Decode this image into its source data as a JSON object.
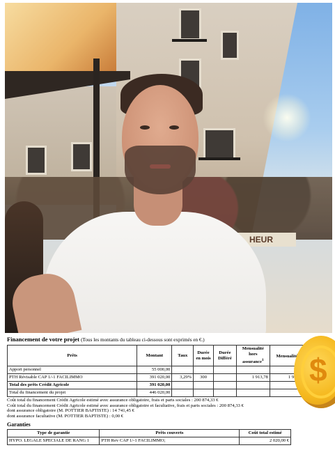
{
  "photo": {
    "sign_text": "HEUR"
  },
  "document": {
    "title": "Financement de votre projet",
    "title_note": "(Tous les montants du tableau ci-dessous sont exprimés en €.)",
    "table": {
      "headers": [
        "Prêts",
        "Montant",
        "Taux",
        "Durée en mois",
        "Durée Différé",
        "Mensualité hors assurance",
        "Mensualité"
      ],
      "header_footnotes": [
        "",
        "",
        "",
        "",
        "",
        "1",
        "2"
      ],
      "rows": [
        [
          "Apport personnel",
          "55 000,00",
          "",
          "",
          "",
          "",
          ""
        ],
        [
          "PTH Révisable CAP 1/-1 FACILIMMO",
          "391 020,00",
          "3,29%",
          "300",
          "",
          "1 913,78",
          "1 962,92"
        ],
        [
          "Total des prêts Crédit Agricole",
          "391 020,00",
          "",
          "",
          "",
          "",
          ""
        ],
        [
          "Total du financement du projet",
          "446 020,00",
          "",
          "",
          "",
          "",
          ""
        ]
      ],
      "extra_header": "M"
    },
    "lines": [
      "Coût total du financement Crédit Agricole estimé avec assurance obligatoire, frais et parts sociales : 200 874,33 €",
      "Coût total du financement Crédit Agricole estimé avec assurance obligatoire et facultative, frais et parts sociales : 200 874,33 €",
      "dont assurance obligatoire (M. POTTIER BAPTISTE) : 14 741,45 €",
      "dont assurance facultative (M. POTTIER BAPTISTE) : 0,00 €"
    ],
    "guarantees": {
      "title": "Garanties",
      "headers": [
        "Type de garantie",
        "Prêts couverts",
        "Coût total estimé"
      ],
      "rows": [
        [
          "HYPO. LEGALE SPECIALE DE RANG 1",
          "PTH Rev CAP 1/-1 FACILIMMO;",
          "2 020,00 €"
        ]
      ]
    }
  },
  "coin": {
    "symbol": "$"
  }
}
